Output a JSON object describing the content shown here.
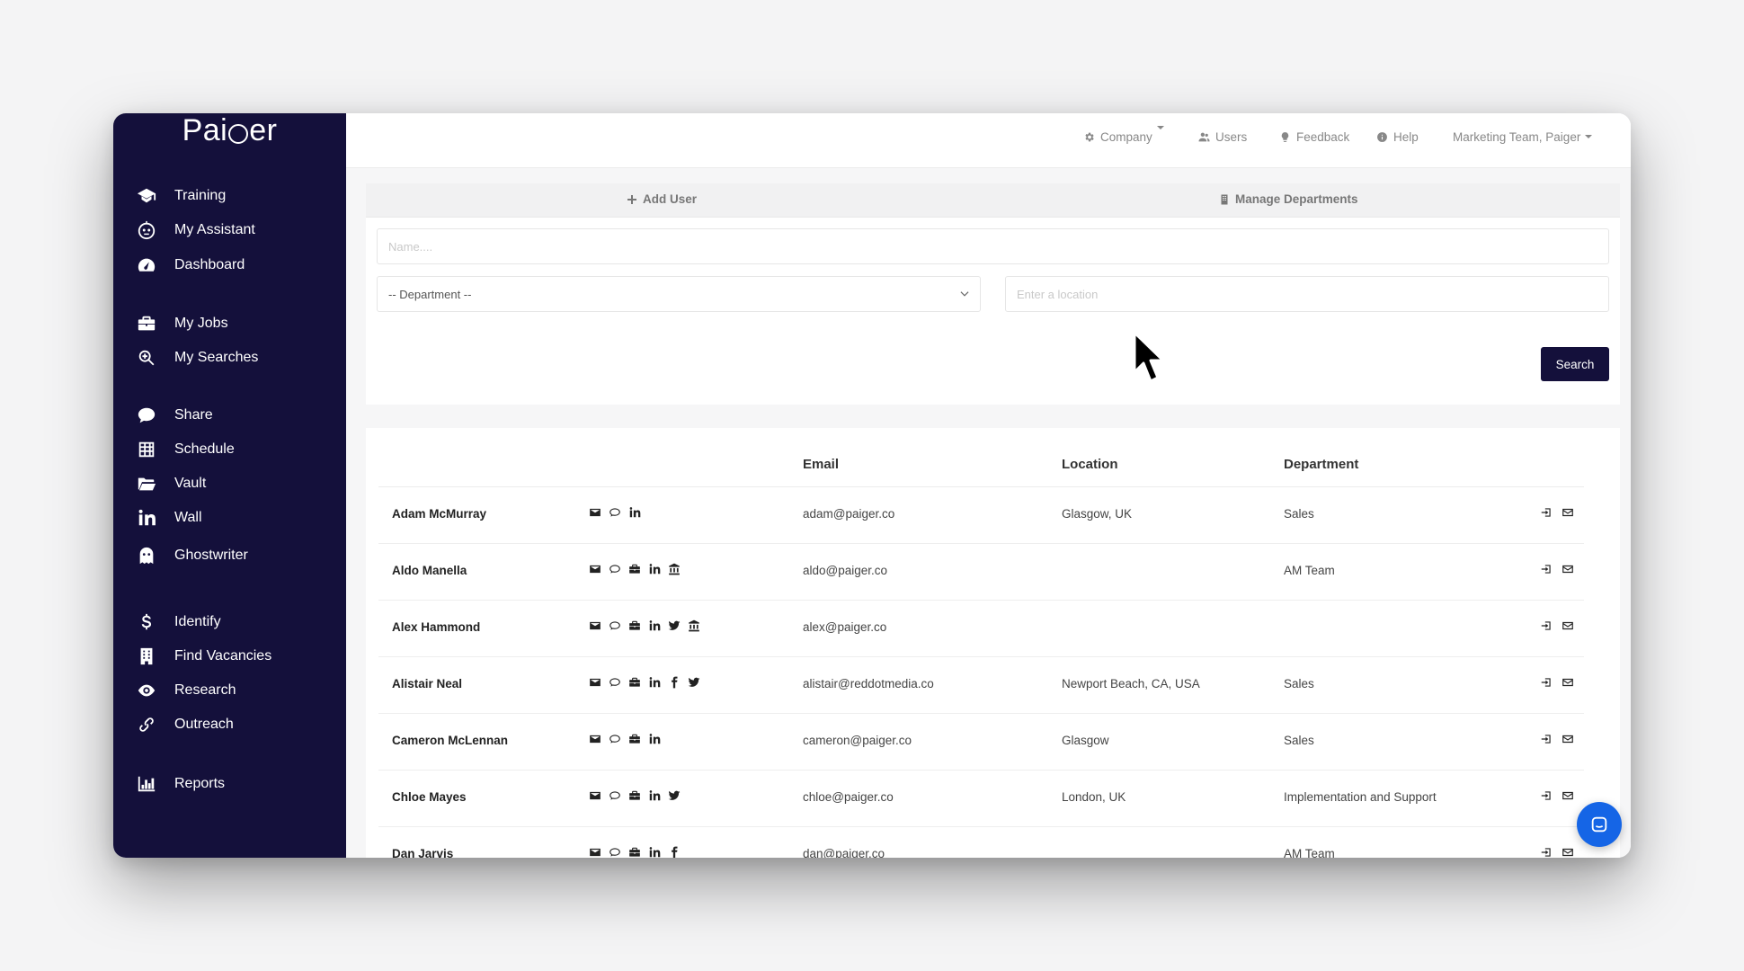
{
  "brand": {
    "name_prefix": "Pai",
    "name_suffix": "er"
  },
  "sidebar": {
    "items": [
      {
        "label": "Training",
        "icon": "graduation-cap-icon"
      },
      {
        "label": "My Assistant",
        "icon": "robot-icon"
      },
      {
        "label": "Dashboard",
        "icon": "dashboard-icon"
      },
      {
        "label": "My Jobs",
        "icon": "briefcase-icon"
      },
      {
        "label": "My Searches",
        "icon": "search-icon"
      },
      {
        "label": "Share",
        "icon": "chat-icon"
      },
      {
        "label": "Schedule",
        "icon": "table-icon"
      },
      {
        "label": "Vault",
        "icon": "folder-icon"
      },
      {
        "label": "Wall",
        "icon": "linkedin-icon"
      },
      {
        "label": "Ghostwriter",
        "icon": "ghost-icon"
      },
      {
        "label": "Identify",
        "icon": "dollar-icon"
      },
      {
        "label": "Find Vacancies",
        "icon": "building-icon"
      },
      {
        "label": "Research",
        "icon": "eye-icon"
      },
      {
        "label": "Outreach",
        "icon": "link-icon"
      },
      {
        "label": "Reports",
        "icon": "bar-chart-icon"
      }
    ]
  },
  "topbar": {
    "company": "Company",
    "users": "Users",
    "feedback": "Feedback",
    "help": "Help",
    "account": "Marketing Team, Paiger"
  },
  "actions": {
    "add_user": "Add User",
    "manage_departments": "Manage Departments"
  },
  "filters": {
    "name_placeholder": "Name....",
    "department_selected": "-- Department --",
    "location_placeholder": "Enter a location",
    "search_label": "Search"
  },
  "table": {
    "headers": {
      "email": "Email",
      "location": "Location",
      "department": "Department"
    },
    "rows": [
      {
        "name": "Adam McMurray",
        "email": "adam@paiger.co",
        "location": "Glasgow, UK",
        "department": "Sales",
        "icons": [
          "envelope",
          "chat",
          "linkedin"
        ]
      },
      {
        "name": "Aldo Manella",
        "email": "aldo@paiger.co",
        "location": "",
        "department": "AM Team",
        "icons": [
          "envelope",
          "chat",
          "briefcase",
          "linkedin",
          "bank"
        ]
      },
      {
        "name": "Alex Hammond",
        "email": "alex@paiger.co",
        "location": "",
        "department": "",
        "icons": [
          "envelope",
          "chat",
          "briefcase",
          "linkedin",
          "twitter",
          "bank"
        ]
      },
      {
        "name": "Alistair Neal",
        "email": "alistair@reddotmedia.co",
        "location": "Newport Beach, CA, USA",
        "department": "Sales",
        "icons": [
          "envelope",
          "chat",
          "briefcase",
          "linkedin",
          "facebook",
          "twitter"
        ]
      },
      {
        "name": "Cameron McLennan",
        "email": "cameron@paiger.co",
        "location": "Glasgow",
        "department": "Sales",
        "icons": [
          "envelope",
          "chat",
          "briefcase",
          "linkedin"
        ]
      },
      {
        "name": "Chloe Mayes",
        "email": "chloe@paiger.co",
        "location": "London, UK",
        "department": "Implementation and Support",
        "icons": [
          "envelope",
          "chat",
          "briefcase",
          "linkedin",
          "twitter"
        ]
      },
      {
        "name": "Dan Jarvis",
        "email": "dan@paiger.co",
        "location": "",
        "department": "AM Team",
        "icons": [
          "envelope",
          "chat",
          "briefcase",
          "linkedin",
          "facebook"
        ]
      }
    ]
  },
  "colors": {
    "sidebar_bg": "#14103b",
    "accent": "#14103b",
    "chat_bubble": "#1565e6"
  }
}
